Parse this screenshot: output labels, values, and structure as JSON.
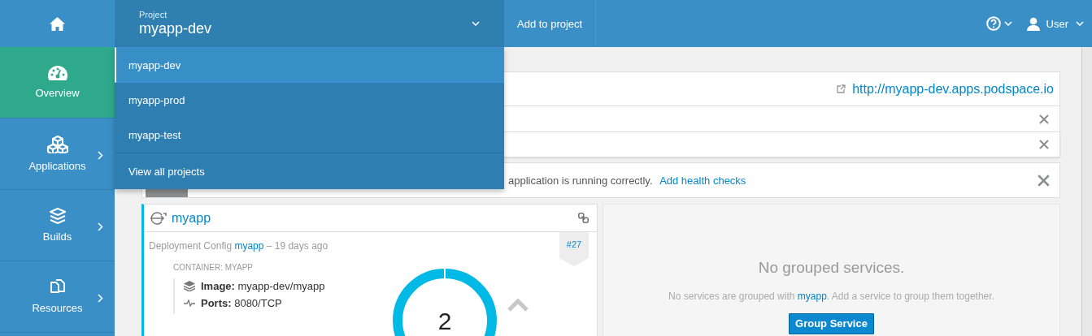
{
  "topbar": {
    "project_label": "Project",
    "project_name": "myapp-dev",
    "add_to_project": "Add to project",
    "user": "User"
  },
  "sidebar": {
    "items": [
      {
        "label": "Overview",
        "kind": "overview",
        "selected": true,
        "has_submenu": false
      },
      {
        "label": "Applications",
        "kind": "applications",
        "selected": false,
        "has_submenu": true
      },
      {
        "label": "Builds",
        "kind": "builds",
        "selected": false,
        "has_submenu": true
      },
      {
        "label": "Resources",
        "kind": "resources",
        "selected": false,
        "has_submenu": true
      }
    ]
  },
  "project_menu": {
    "items": [
      {
        "label": "myapp-dev",
        "selected": true
      },
      {
        "label": "myapp-prod",
        "selected": false
      },
      {
        "label": "myapp-test",
        "selected": false
      }
    ],
    "footer": "View all projects"
  },
  "route": {
    "url": "http://myapp-dev.apps.podspace.io"
  },
  "notices": [
    {
      "kind": "covered",
      "dismissible": true
    },
    {
      "kind": "covered",
      "dismissible": true
    },
    {
      "kind": "health",
      "dismissible": true,
      "text": "application is running correctly.",
      "link": "Add health checks"
    }
  ],
  "deployment": {
    "name": "myapp",
    "config_label": "Deployment Config",
    "config_link": "myapp",
    "age": "– 19 days ago",
    "badge": "#27",
    "container": "CONTAINER: MYAPP",
    "details": [
      {
        "kind": "image",
        "text": "**Image:** myapp-dev/myapp"
      },
      {
        "kind": "ports",
        "text": "**Ports:** 8080/TCP"
      }
    ],
    "pods": "2"
  },
  "grouping": {
    "title": "No grouped services.",
    "text_before": "No services are grouped with ",
    "link": "myapp",
    "text_after": ". Add a service to group them together.",
    "button": "Group Service"
  }
}
